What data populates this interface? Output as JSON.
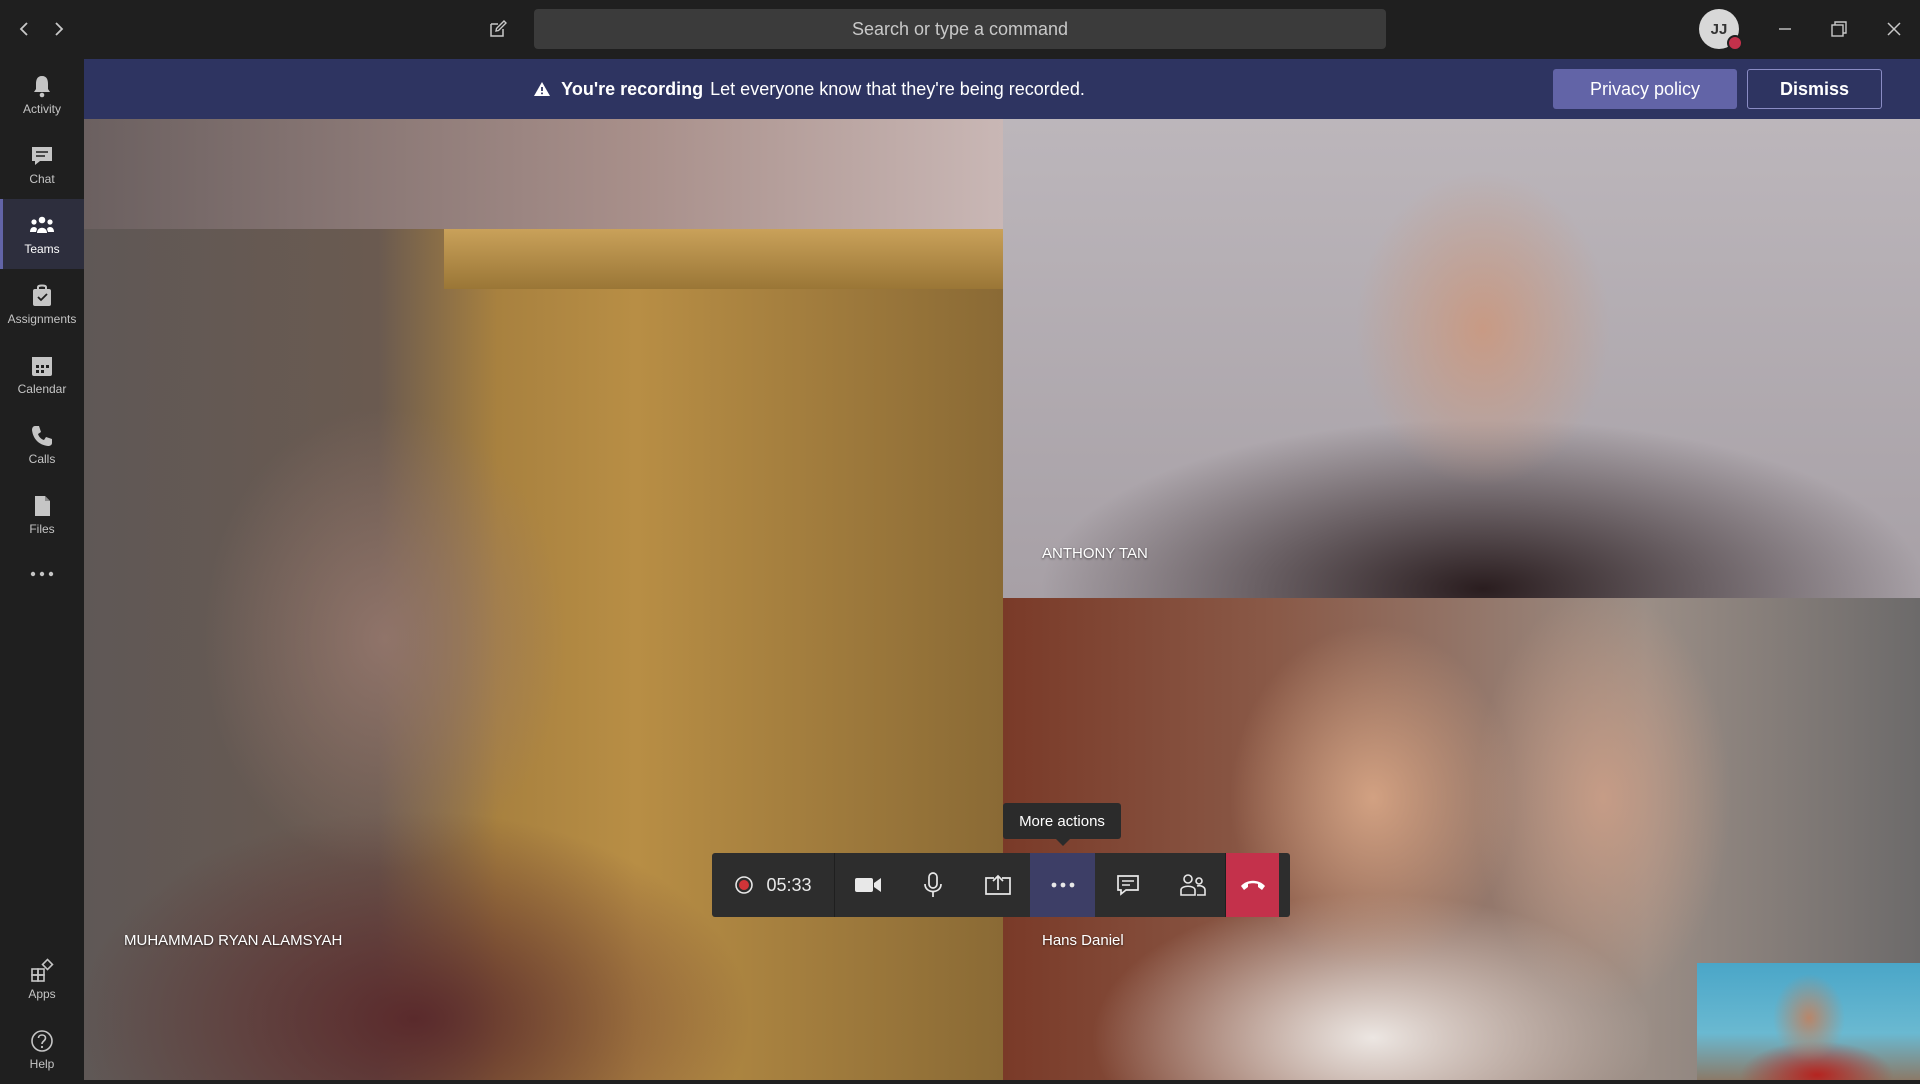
{
  "titlebar": {
    "search_placeholder": "Search or type a command",
    "avatar_initials": "JJ",
    "presence_color": "#c4314b"
  },
  "rail": {
    "items": [
      {
        "label": "Activity",
        "icon": "bell-icon"
      },
      {
        "label": "Chat",
        "icon": "chat-icon"
      },
      {
        "label": "Teams",
        "icon": "teams-icon",
        "active": true
      },
      {
        "label": "Assignments",
        "icon": "assignments-icon"
      },
      {
        "label": "Calendar",
        "icon": "calendar-icon"
      },
      {
        "label": "Calls",
        "icon": "phone-icon"
      },
      {
        "label": "Files",
        "icon": "file-icon"
      }
    ],
    "bottom": [
      {
        "label": "Apps",
        "icon": "apps-icon"
      },
      {
        "label": "Help",
        "icon": "help-icon"
      }
    ],
    "accent": "#6264a7"
  },
  "banner": {
    "title": "You're recording",
    "message": "Let everyone know that they're being recorded.",
    "privacy_label": "Privacy policy",
    "dismiss_label": "Dismiss",
    "background": "#2e3461"
  },
  "participants": [
    {
      "name": "MUHAMMAD RYAN ALAMSYAH"
    },
    {
      "name": "ANTHONY TAN"
    },
    {
      "name": "Hans Daniel"
    }
  ],
  "controls": {
    "timer": "05:33",
    "tooltip": "More actions",
    "hangup_color": "#c4314b"
  }
}
